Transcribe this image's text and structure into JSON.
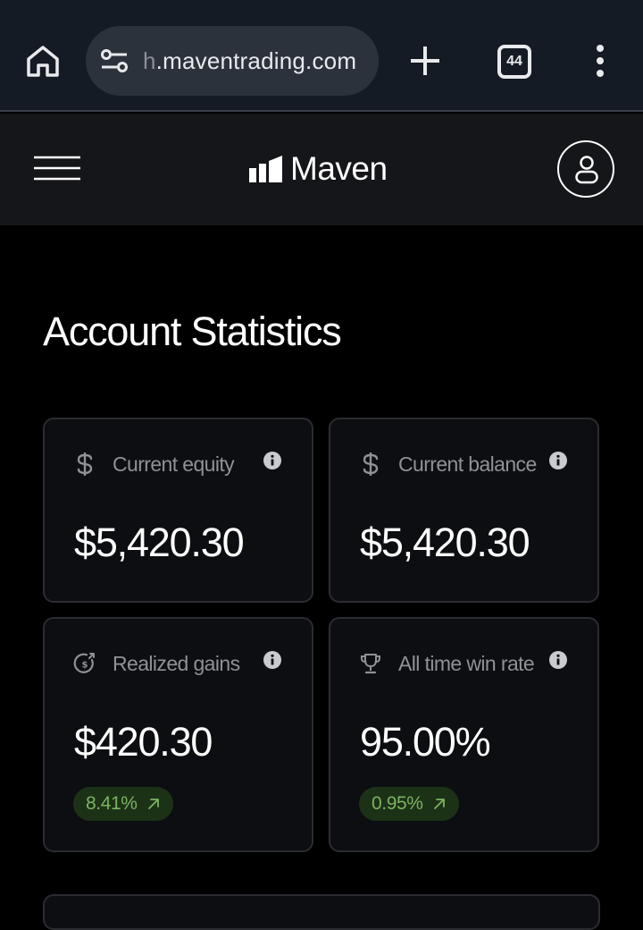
{
  "browser": {
    "url_dim": "h",
    "url_main": ".maventrading.com",
    "tab_count": "44"
  },
  "header": {
    "brand_name": "Maven"
  },
  "page": {
    "title": "Account Statistics"
  },
  "stats": [
    {
      "label": "Current equity",
      "value": "$5,420.30",
      "icon": "dollar-icon"
    },
    {
      "label": "Current balance",
      "value": "$5,420.30",
      "icon": "dollar-icon"
    },
    {
      "label": "Realized gains",
      "value": "$420.30",
      "icon": "dollar-refresh-icon",
      "change": "8.41%"
    },
    {
      "label": "All time win rate",
      "value": "95.00%",
      "icon": "trophy-icon",
      "change": "0.95%"
    }
  ],
  "colors": {
    "positive_text": "#7bb35f",
    "positive_bg": "#1c3217",
    "card_bg": "#0d0e11",
    "card_border": "#2a2c31"
  }
}
